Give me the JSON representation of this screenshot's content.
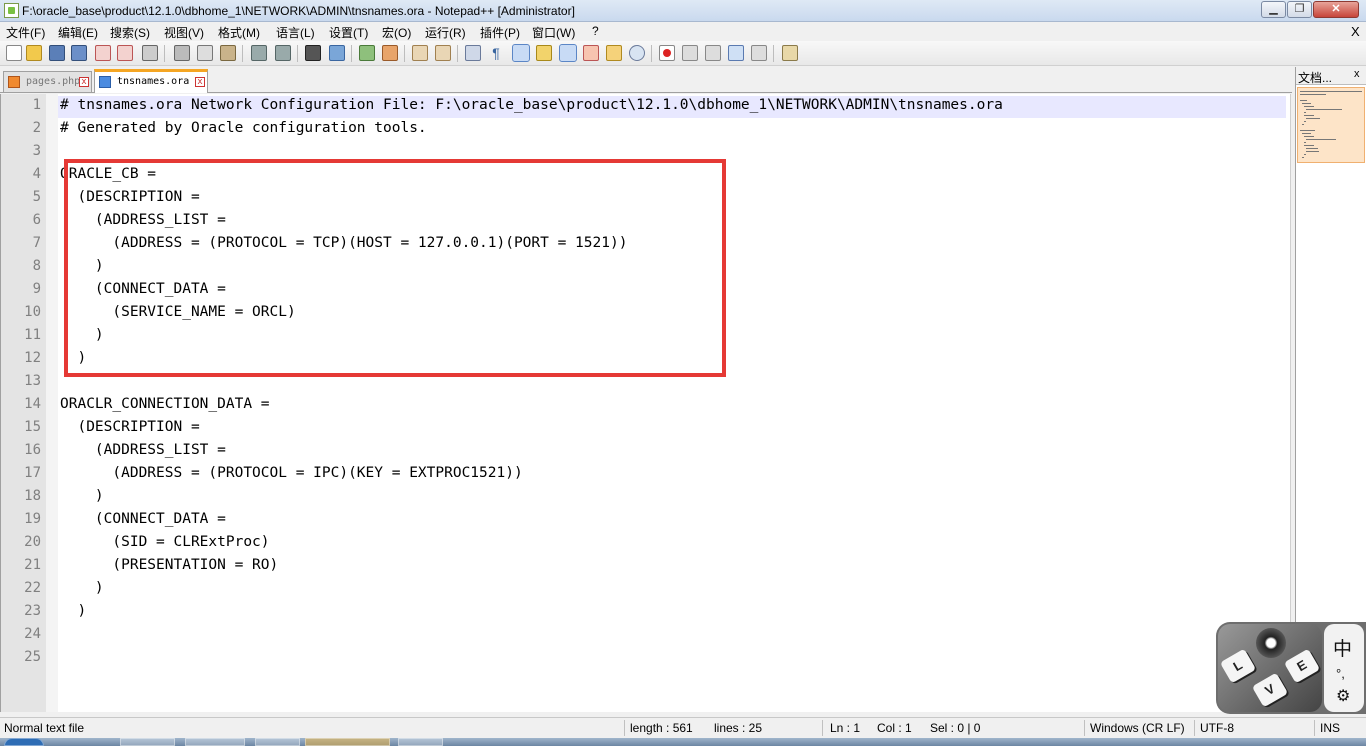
{
  "window": {
    "title": "F:\\oracle_base\\product\\12.1.0\\dbhome_1\\NETWORK\\ADMIN\\tnsnames.ora - Notepad++ [Administrator]",
    "minimize_label": "▁",
    "maximize_label": "❐",
    "close_label": "✕"
  },
  "menu": {
    "items": [
      "文件(F)",
      "编辑(E)",
      "搜索(S)",
      "视图(V)",
      "格式(M)",
      "语言(L)",
      "设置(T)",
      "宏(O)",
      "运行(R)",
      "插件(P)",
      "窗口(W)",
      "?"
    ],
    "close_label": "X"
  },
  "toolbar": {
    "icons": [
      "new-file-icon",
      "open-file-icon",
      "save-icon",
      "save-all-icon",
      "close-icon",
      "close-all-icon",
      "print-icon",
      "cut-icon",
      "copy-icon",
      "paste-icon",
      "undo-icon",
      "redo-icon",
      "find-icon",
      "replace-icon",
      "zoom-in-icon",
      "zoom-out-icon",
      "sync-vertical-icon",
      "sync-horizontal-icon",
      "word-wrap-icon",
      "show-all-chars-icon",
      "indent-guide-icon",
      "user-defined-language-icon",
      "doc-map-icon",
      "function-list-icon",
      "folder-as-workspace-icon",
      "monitoring-icon",
      "record-macro-icon",
      "stop-record-icon",
      "playback-macro-icon",
      "run-macro-multiple-icon",
      "save-macro-icon",
      "run-icon"
    ]
  },
  "tabs": [
    {
      "label": "pages.php",
      "close": "x"
    },
    {
      "label": "tnsnames.ora",
      "close": "x"
    }
  ],
  "editor": {
    "line_numbers": [
      "1",
      "2",
      "3",
      "4",
      "5",
      "6",
      "7",
      "8",
      "9",
      "10",
      "11",
      "12",
      "13",
      "14",
      "15",
      "16",
      "17",
      "18",
      "19",
      "20",
      "21",
      "22",
      "23",
      "24",
      "25"
    ],
    "lines": [
      "# tnsnames.ora Network Configuration File: F:\\oracle_base\\product\\12.1.0\\dbhome_1\\NETWORK\\ADMIN\\tnsnames.ora",
      "# Generated by Oracle configuration tools.",
      "",
      "ORACLE_CB =",
      "  (DESCRIPTION =",
      "    (ADDRESS_LIST =",
      "      (ADDRESS = (PROTOCOL = TCP)(HOST = 127.0.0.1)(PORT = 1521))",
      "    )",
      "    (CONNECT_DATA =",
      "      (SERVICE_NAME = ORCL)",
      "    )",
      "  )",
      "",
      "ORACLR_CONNECTION_DATA =",
      "  (DESCRIPTION =",
      "    (ADDRESS_LIST =",
      "      (ADDRESS = (PROTOCOL = IPC)(KEY = EXTPROC1521))",
      "    )",
      "    (CONNECT_DATA =",
      "      (SID = CLRExtProc)",
      "      (PRESENTATION = RO)",
      "    )",
      "  )",
      "",
      ""
    ],
    "highlight_color": "#e53935"
  },
  "docmap": {
    "title": "文档...",
    "close_label": "x"
  },
  "status": {
    "file_type": "Normal text file",
    "length": "length : 561",
    "lines": "lines : 25",
    "ln": "Ln : 1",
    "col": "Col : 1",
    "sel": "Sel : 0 | 0",
    "eol": "Windows (CR LF)",
    "encoding": "UTF-8",
    "mode": "INS"
  },
  "ime": {
    "keys": [
      "L",
      "O",
      "V",
      "E"
    ],
    "language": "中",
    "punctuation": "°,",
    "settings_icon": "gear-icon"
  }
}
